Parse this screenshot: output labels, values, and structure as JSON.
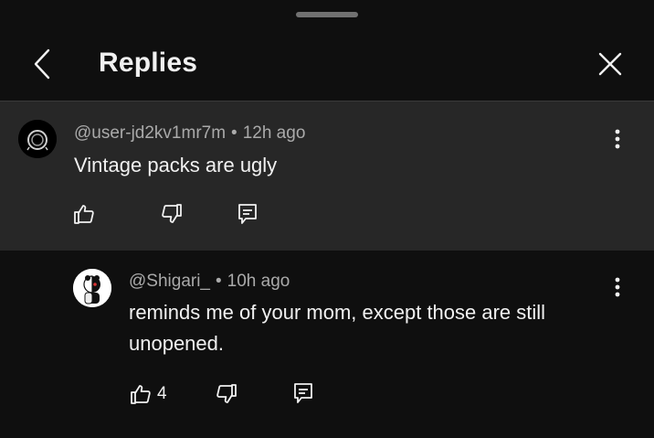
{
  "header": {
    "title": "Replies"
  },
  "parent_comment": {
    "author": "@user-jd2kv1mr7m",
    "separator": "•",
    "time": "12h ago",
    "text": "Vintage packs are ugly",
    "likes": ""
  },
  "reply_comment": {
    "author": "@Shigari_",
    "separator": "•",
    "time": "10h ago",
    "text": "reminds me of your mom, except those are still unopened.",
    "likes": "4"
  },
  "colors": {
    "background": "#0f0f0f",
    "highlight": "#272727",
    "text": "#f1f1f1",
    "meta": "#aaaaaa"
  }
}
